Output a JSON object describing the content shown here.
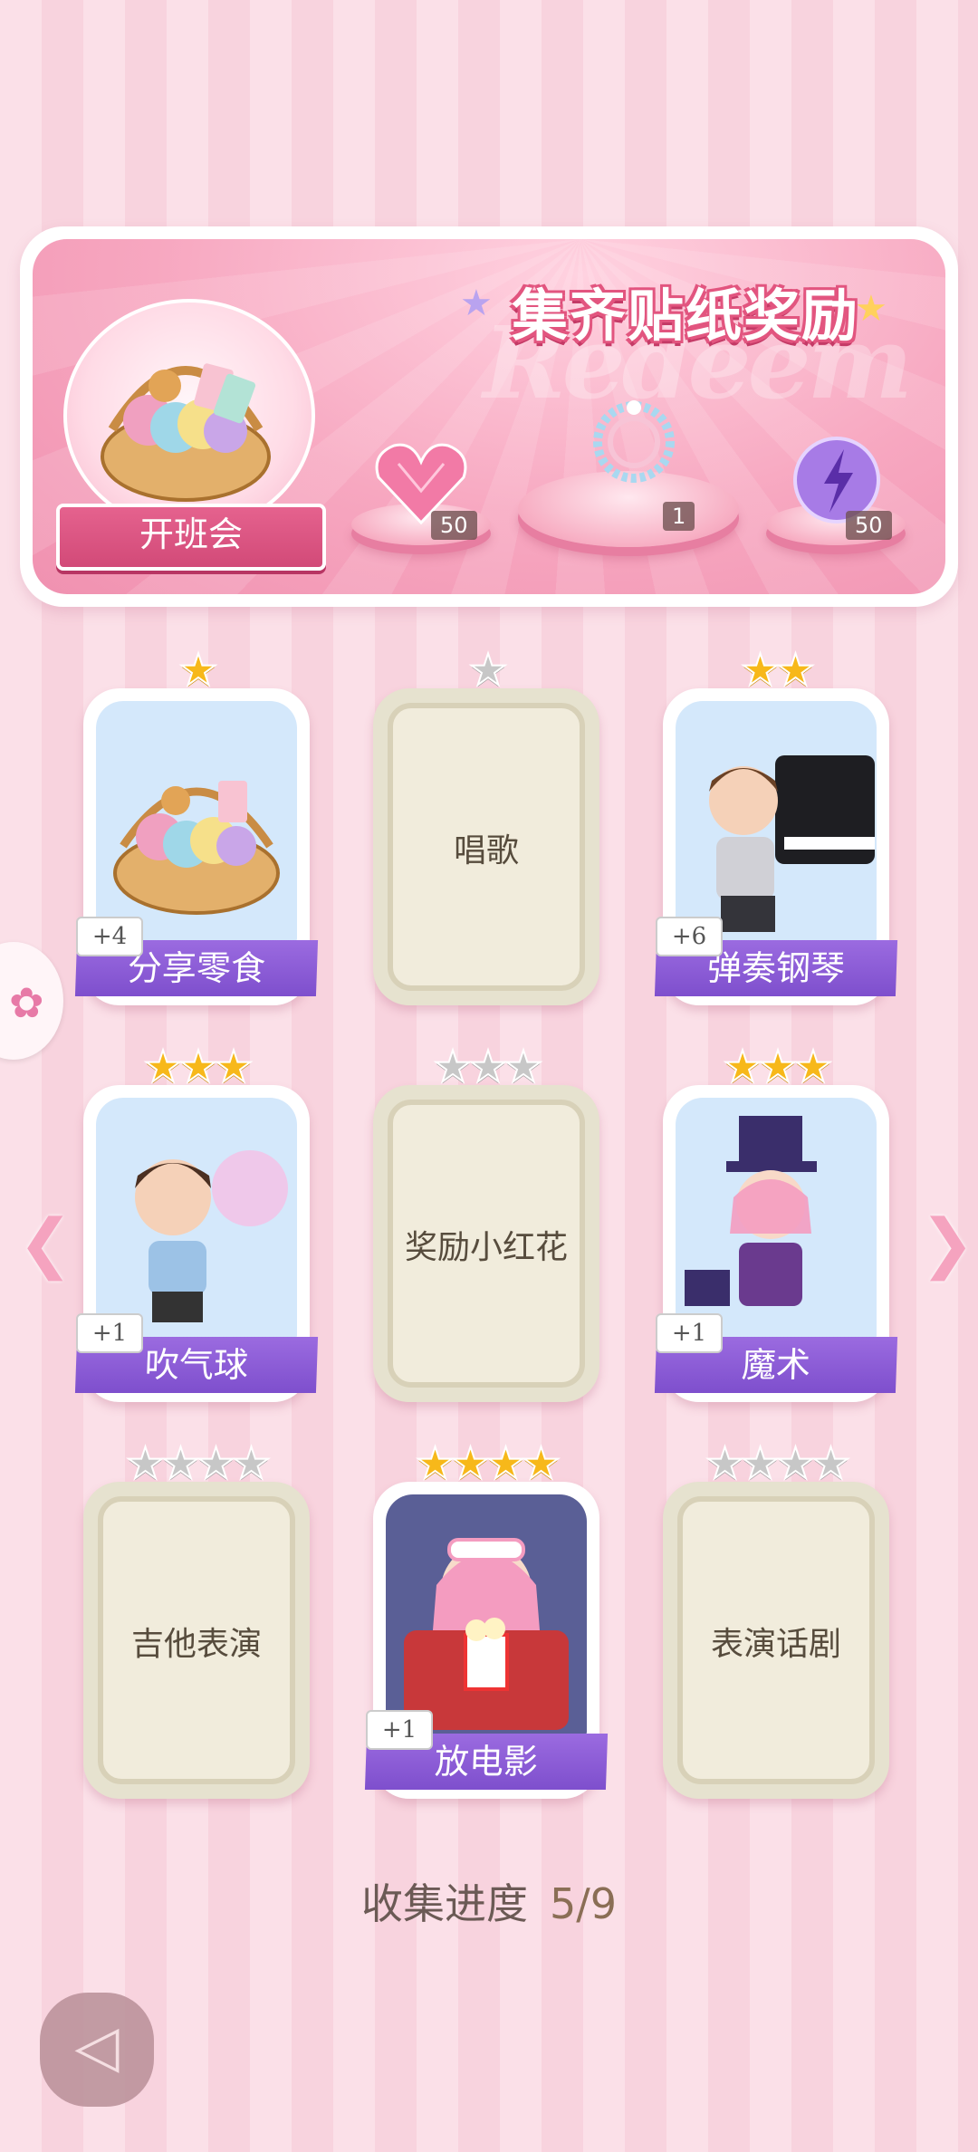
{
  "banner": {
    "title": "集齐贴纸奖励",
    "watermark": "Redeem",
    "event_label": "开班会",
    "rewards": [
      {
        "icon": "pink-heart-gem-icon",
        "count": "50"
      },
      {
        "icon": "gem-bracelet-icon",
        "count": "1"
      },
      {
        "icon": "purple-energy-orb-icon",
        "count": "50"
      }
    ]
  },
  "cards": [
    {
      "label": "分享零食",
      "stars_filled": 1,
      "stars_total": 1,
      "unlocked": true,
      "bonus": "+4",
      "icon": "snack-basket-icon"
    },
    {
      "label": "唱歌",
      "stars_filled": 0,
      "stars_total": 1,
      "unlocked": false,
      "bonus": "",
      "icon": ""
    },
    {
      "label": "弹奏钢琴",
      "stars_filled": 2,
      "stars_total": 2,
      "unlocked": true,
      "bonus": "+6",
      "icon": "boy-piano-icon"
    },
    {
      "label": "吹气球",
      "stars_filled": 3,
      "stars_total": 3,
      "unlocked": true,
      "bonus": "+1",
      "icon": "boy-balloon-icon"
    },
    {
      "label": "奖励小红花",
      "stars_filled": 0,
      "stars_total": 3,
      "unlocked": false,
      "bonus": "",
      "icon": ""
    },
    {
      "label": "魔术",
      "stars_filled": 3,
      "stars_total": 3,
      "unlocked": true,
      "bonus": "+1",
      "icon": "magician-girl-icon"
    },
    {
      "label": "吉他表演",
      "stars_filled": 0,
      "stars_total": 4,
      "unlocked": false,
      "bonus": "",
      "icon": ""
    },
    {
      "label": "放电影",
      "stars_filled": 4,
      "stars_total": 4,
      "unlocked": true,
      "bonus": "+1",
      "icon": "girl-popcorn-icon"
    },
    {
      "label": "表演话剧",
      "stars_filled": 0,
      "stars_total": 4,
      "unlocked": false,
      "bonus": "",
      "icon": ""
    }
  ],
  "progress": {
    "label": "收集进度",
    "value": "5/9"
  },
  "colors": {
    "accent_pink": "#e5628e",
    "label_purple": "#8a58d6",
    "star_gold": "#f7b81a",
    "star_gray": "#c7c7c7",
    "locked_bg": "#f1ecdc"
  }
}
